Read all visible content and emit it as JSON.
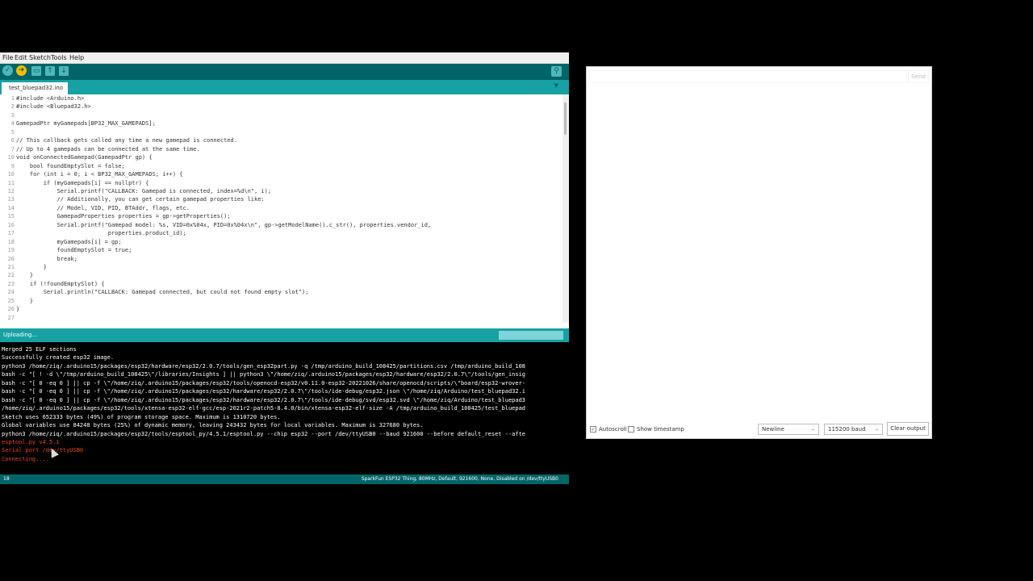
{
  "menu": [
    "File",
    "Edit",
    "Sketch",
    "Tools",
    "Help"
  ],
  "toolbar": {
    "verify_icon": "checkmark-icon",
    "upload_icon": "arrow-right-icon",
    "new_icon": "new-file-icon",
    "open_icon": "open-arrow-up-icon",
    "save_icon": "save-arrow-down-icon",
    "serial_monitor_icon": "magnifier-icon"
  },
  "tab": {
    "name": "test_bluepad32.ino",
    "menu_glyph": "▼"
  },
  "code_lines": [
    {
      "n": "1",
      "text": "#include <Arduino.h>"
    },
    {
      "n": "2",
      "text": "#include <Bluepad32.h>"
    },
    {
      "n": "3",
      "text": ""
    },
    {
      "n": "4",
      "text": "GamepadPtr myGamepads[BP32_MAX_GAMEPADS];"
    },
    {
      "n": "5",
      "text": ""
    },
    {
      "n": "6",
      "text": "// This callback gets called any time a new gamepad is connected."
    },
    {
      "n": "7",
      "text": "// Up to 4 gamepads can be connected at the same time."
    },
    {
      "n": "10",
      "text": "void onConnectedGamepad(GamepadPtr gp) {"
    },
    {
      "n": "9",
      "text": "    bool foundEmptySlot = false;"
    },
    {
      "n": "10",
      "text": "    for (int i = 0; i < BP32_MAX_GAMEPADS; i++) {"
    },
    {
      "n": "11",
      "text": "        if (myGamepads[i] == nullptr) {"
    },
    {
      "n": "12",
      "text": "            Serial.printf(\"CALLBACK: Gamepad is connected, index=%d\\n\", i);"
    },
    {
      "n": "13",
      "text": "            // Additionally, you can get certain gamepad properties like:"
    },
    {
      "n": "14",
      "text": "            // Model, VID, PID, BTAddr, flags, etc."
    },
    {
      "n": "15",
      "text": "            GamepadProperties properties = gp->getProperties();"
    },
    {
      "n": "16",
      "text": "            Serial.printf(\"Gamepad model: %s, VID=0x%04x, PID=0x%04x\\n\", gp->getModelName().c_str(), properties.vendor_id,"
    },
    {
      "n": "17",
      "text": "                           properties.product_id);"
    },
    {
      "n": "18",
      "text": "            myGamepads[i] = gp;"
    },
    {
      "n": "19",
      "text": "            foundEmptySlot = true;"
    },
    {
      "n": "20",
      "text": "            break;"
    },
    {
      "n": "21",
      "text": "        }"
    },
    {
      "n": "22",
      "text": "    }"
    },
    {
      "n": "23",
      "text": "    if (!foundEmptySlot) {"
    },
    {
      "n": "24",
      "text": "        Serial.println(\"CALLBACK: Gamepad connected, but could not found empty slot\");"
    },
    {
      "n": "25",
      "text": "    }"
    },
    {
      "n": "26",
      "text": "}"
    },
    {
      "n": "27",
      "text": ""
    }
  ],
  "status": {
    "text": "Uploading..."
  },
  "console_lines": [
    {
      "text": "Merged 25 ELF sections",
      "err": false
    },
    {
      "text": "Successfully created esp32 image.",
      "err": false
    },
    {
      "text": "python3 /home/ziq/.arduino15/packages/esp32/hardware/esp32/2.0.7/tools/gen_esp32part.py -q /tmp/arduino_build_108425/partitions.csv /tmp/arduino_build_108",
      "err": false
    },
    {
      "text": "bash -c \"[ ! -d \\\"/tmp/arduino_build_108425\\\"/libraries/Insights ] || python3 \\\"/home/ziq/.arduino15/packages/esp32/hardware/esp32/2.0.7\\\"/tools/gen_insig",
      "err": false
    },
    {
      "text": "bash -c \"[ 0 -eq 0 ] || cp -f \\\"/home/ziq/.arduino15/packages/esp32/tools/openocd-esp32/v0.11.0-esp32-20221026/share/openocd/scripts/\\\"board/esp32-wrover-",
      "err": false
    },
    {
      "text": "bash -c \"[ 0 -eq 0 ] || cp -f \\\"/home/ziq/.arduino15/packages/esp32/hardware/esp32/2.0.7\\\"/tools/ide-debug/esp32.json \\\"/home/ziq/Arduino/test_bluepad32.i",
      "err": false
    },
    {
      "text": "bash -c \"[ 0 -eq 0 ] || cp -f \\\"/home/ziq/.arduino15/packages/esp32/hardware/esp32/2.0.7\\\"/tools/ide-debug/svd/esp32.svd \\\"/home/ziq/Arduino/test_bluepad3",
      "err": false
    },
    {
      "text": "/home/ziq/.arduino15/packages/esp32/tools/xtensa-esp32-elf-gcc/esp-2021r2-patch5-8.4.0/bin/xtensa-esp32-elf-size -A /tmp/arduino_build_108425/test_bluepad",
      "err": false
    },
    {
      "text": "Sketch uses 652333 bytes (49%) of program storage space. Maximum is 1310720 bytes.",
      "err": false
    },
    {
      "text": "Global variables use 84248 bytes (25%) of dynamic memory, leaving 243432 bytes for local variables. Maximum is 327680 bytes.",
      "err": false
    },
    {
      "text": "python3 /home/ziq/.arduino15/packages/esp32/tools/esptool_py/4.5.1/esptool.py --chip esp32 --port /dev/ttyUSB0 --baud 921600 --before default_reset --afte",
      "err": false
    },
    {
      "text": "esptool.py v4.5.1",
      "err": true
    },
    {
      "text": "Serial port /dev/ttyUSB0",
      "err": true
    },
    {
      "text": "Connecting....",
      "err": true
    }
  ],
  "footer": {
    "line_number": "18",
    "board": "SparkFun ESP32 Thing, 80MHz, Default, 921600, None, Disabled on /dev/ttyUSB0"
  },
  "serial_monitor": {
    "input_value": "",
    "send_label": "Send",
    "autoscroll_label": "Autoscroll",
    "autoscroll_checked": true,
    "timestamp_label": "Show timestamp",
    "timestamp_checked": false,
    "line_ending": "Newline",
    "baud": "115200 baud",
    "clear_label": "Clear output"
  }
}
